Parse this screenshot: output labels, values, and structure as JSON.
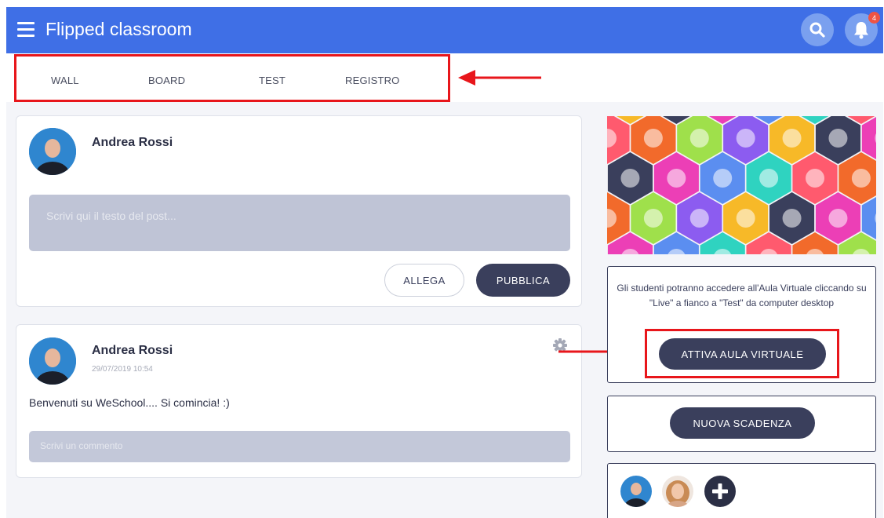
{
  "header": {
    "title": "Flipped classroom",
    "notification_count": "4",
    "brand_color": "#3f6fe6"
  },
  "tabs": [
    {
      "label": "WALL"
    },
    {
      "label": "BOARD"
    },
    {
      "label": "TEST"
    },
    {
      "label": "REGISTRO"
    }
  ],
  "composer": {
    "author": "Andrea Rossi",
    "placeholder": "Scrivi qui il testo del post...",
    "attach_label": "ALLEGA",
    "publish_label": "PUBBLICA"
  },
  "post": {
    "author": "Andrea Rossi",
    "timestamp": "29/07/2019 10:54",
    "body": "Benvenuti su WeSchool.... Si comincia! :)",
    "comment_placeholder": "Scrivi un commento"
  },
  "sidebar": {
    "virtual_room_info": "Gli studenti potranno accedere all'Aula Virtuale cliccando su \"Live\" a fianco a \"Test\" da computer desktop",
    "activate_label": "ATTIVA AULA VIRTUALE",
    "deadline_label": "NUOVA SCADENZA"
  },
  "icons": {
    "menu": "hamburger-menu-icon",
    "search": "search-icon",
    "bell": "bell-icon",
    "gear": "gear-icon",
    "plus": "plus-icon"
  }
}
